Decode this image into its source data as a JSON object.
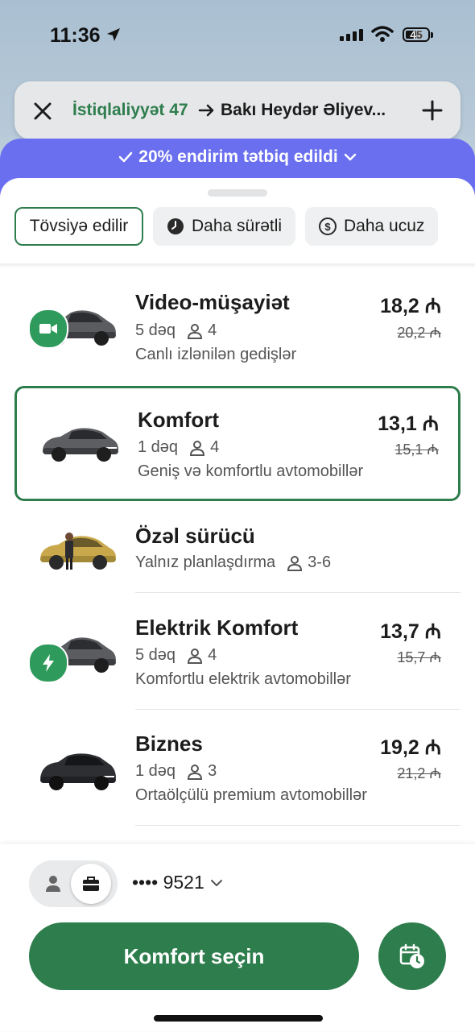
{
  "status_bar": {
    "time": "11:36",
    "battery": "45"
  },
  "route": {
    "from": "İstiqlaliyyət 47",
    "to": "Bakı Heydər Əliyev..."
  },
  "discount_banner": "20% endirim tətbiq edildi",
  "filters": [
    {
      "label": "Tövsiyə edilir",
      "icon": null,
      "active": true
    },
    {
      "label": "Daha sürətli",
      "icon": "clock-icon",
      "active": false
    },
    {
      "label": "Daha ucuz",
      "icon": "dollar-coin-icon",
      "active": false
    }
  ],
  "rides": [
    {
      "name": "Video-müşayiət",
      "eta": "5 dəq",
      "seats": "4",
      "description": "Canlı izlənilən gedişlər",
      "price": "18,2 ₼",
      "old_price": "20,2 ₼",
      "badge": "video-camera-icon"
    },
    {
      "name": "Komfort",
      "eta": "1 dəq",
      "seats": "4",
      "description": "Geniş və komfortlu avtomobillər",
      "price": "13,1 ₼",
      "old_price": "15,1 ₼",
      "selected": true
    },
    {
      "name": "Özəl sürücü",
      "eta": "Yalnız planlaşdırma",
      "seats": "3-6",
      "description": ""
    },
    {
      "name": "Elektrik Komfort",
      "eta": "5 dəq",
      "seats": "4",
      "description": "Komfortlu elektrik avtomobillər",
      "price": "13,7 ₼",
      "old_price": "15,7 ₼",
      "badge": "lightning-icon"
    },
    {
      "name": "Biznes",
      "eta": "1 dəq",
      "seats": "3",
      "description": "Ortaölçülü premium avtomobillər",
      "price": "19,2 ₼",
      "old_price": "21,2 ₼"
    }
  ],
  "payment": {
    "card": "•••• 9521"
  },
  "cta_label": "Komfort seçin",
  "colors": {
    "brand_green": "#2e7d4d",
    "discount_purple": "#6a6ff0"
  }
}
